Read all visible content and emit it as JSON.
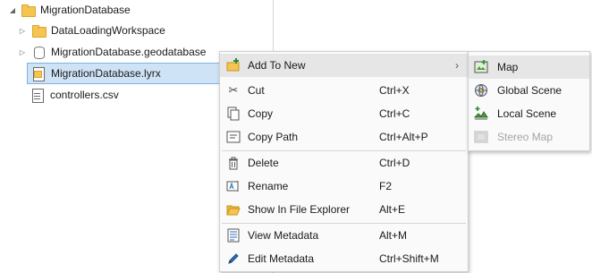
{
  "tree": {
    "items": [
      {
        "label": "MigrationDatabase",
        "icon": "folder-icon"
      },
      {
        "label": "DataLoadingWorkspace",
        "icon": "folder-icon"
      },
      {
        "label": "MigrationDatabase.geodatabase",
        "icon": "geodatabase-icon"
      },
      {
        "label": "MigrationDatabase.lyrx",
        "icon": "layer-file-icon"
      },
      {
        "label": "controllers.csv",
        "icon": "csv-file-icon"
      }
    ]
  },
  "context_menu": {
    "items": [
      {
        "label": "Add To New",
        "shortcut": "",
        "icon": "add-icon"
      },
      {
        "label": "Cut",
        "shortcut": "Ctrl+X",
        "icon": "scissors-icon"
      },
      {
        "label": "Copy",
        "shortcut": "Ctrl+C",
        "icon": "copy-icon"
      },
      {
        "label": "Copy Path",
        "shortcut": "Ctrl+Alt+P",
        "icon": "copy-path-icon"
      },
      {
        "label": "Delete",
        "shortcut": "Ctrl+D",
        "icon": "trash-icon"
      },
      {
        "label": "Rename",
        "shortcut": "F2",
        "icon": "rename-icon"
      },
      {
        "label": "Show In File Explorer",
        "shortcut": "Alt+E",
        "icon": "open-folder-icon"
      },
      {
        "label": "View Metadata",
        "shortcut": "Alt+M",
        "icon": "metadata-icon"
      },
      {
        "label": "Edit Metadata",
        "shortcut": "Ctrl+Shift+M",
        "icon": "pencil-icon"
      }
    ],
    "submenu_arrow": "›"
  },
  "submenu": {
    "items": [
      {
        "label": "Map",
        "icon": "map-icon"
      },
      {
        "label": "Global Scene",
        "icon": "globe-icon"
      },
      {
        "label": "Local Scene",
        "icon": "local-scene-icon"
      },
      {
        "label": "Stereo Map",
        "icon": "stereo-map-icon",
        "disabled": true
      }
    ]
  },
  "colors": {
    "selection": "#cfe3f7",
    "folder": "#f5c451",
    "menu_highlight": "#e6e6e6"
  }
}
